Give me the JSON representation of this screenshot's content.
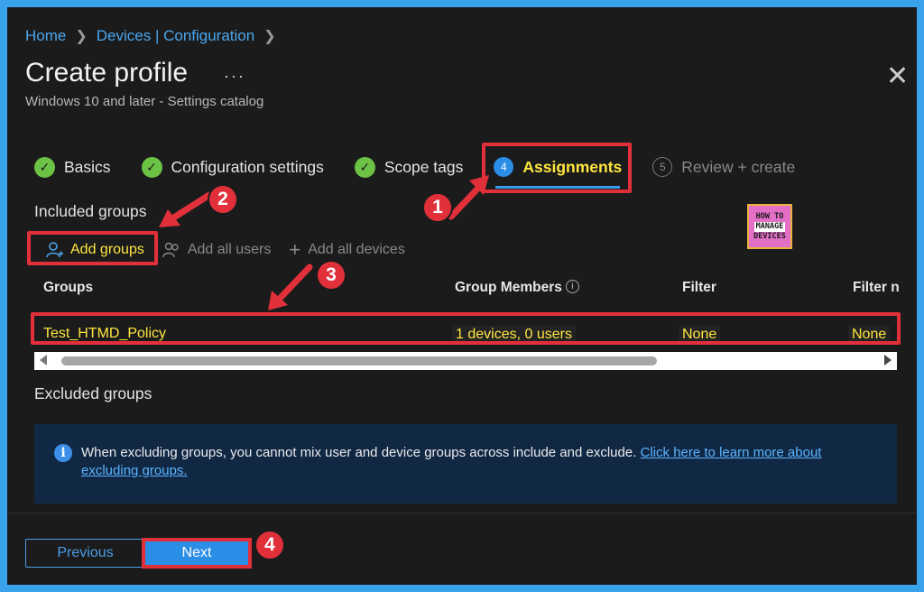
{
  "breadcrumb": {
    "home": "Home",
    "devices": "Devices | Configuration"
  },
  "header": {
    "title": "Create profile",
    "more": "···",
    "subtitle": "Windows 10 and later - Settings catalog"
  },
  "steps": [
    {
      "label": "Basics",
      "status": "done"
    },
    {
      "label": "Configuration settings",
      "status": "done"
    },
    {
      "label": "Scope tags",
      "status": "done"
    },
    {
      "num": "4",
      "label": "Assignments",
      "status": "active"
    },
    {
      "num": "5",
      "label": "Review + create",
      "status": "disabled"
    }
  ],
  "included": {
    "label": "Included groups",
    "actions": {
      "add_groups": "Add groups",
      "add_all_users": "Add all users",
      "add_all_devices": "Add all devices"
    },
    "columns": {
      "groups": "Groups",
      "members": "Group Members",
      "filter": "Filter",
      "filter_mode": "Filter n"
    },
    "rows": [
      {
        "group": "Test_HTMD_Policy",
        "members": "1 devices, 0 users",
        "filter": "None",
        "filter_mode": "None"
      }
    ]
  },
  "excluded": {
    "label": "Excluded groups",
    "info_text": "When excluding groups, you cannot mix user and device groups across include and exclude.",
    "info_link": "Click here to learn more about excluding groups."
  },
  "footer": {
    "previous": "Previous",
    "next": "Next"
  },
  "annotations": {
    "b1": "1",
    "b2": "2",
    "b3": "3",
    "b4": "4"
  },
  "logo": {
    "line1": "HOW TO",
    "line2": "MANAGE",
    "line3": "DEVICES"
  },
  "colors": {
    "accent": "#2b8ee6",
    "highlight_text": "#ffe640",
    "annotation_red": "#e2303a",
    "success_green": "#6cc244",
    "panel_bg": "#1b1b1b",
    "frame_blue": "#3aa2ec"
  }
}
